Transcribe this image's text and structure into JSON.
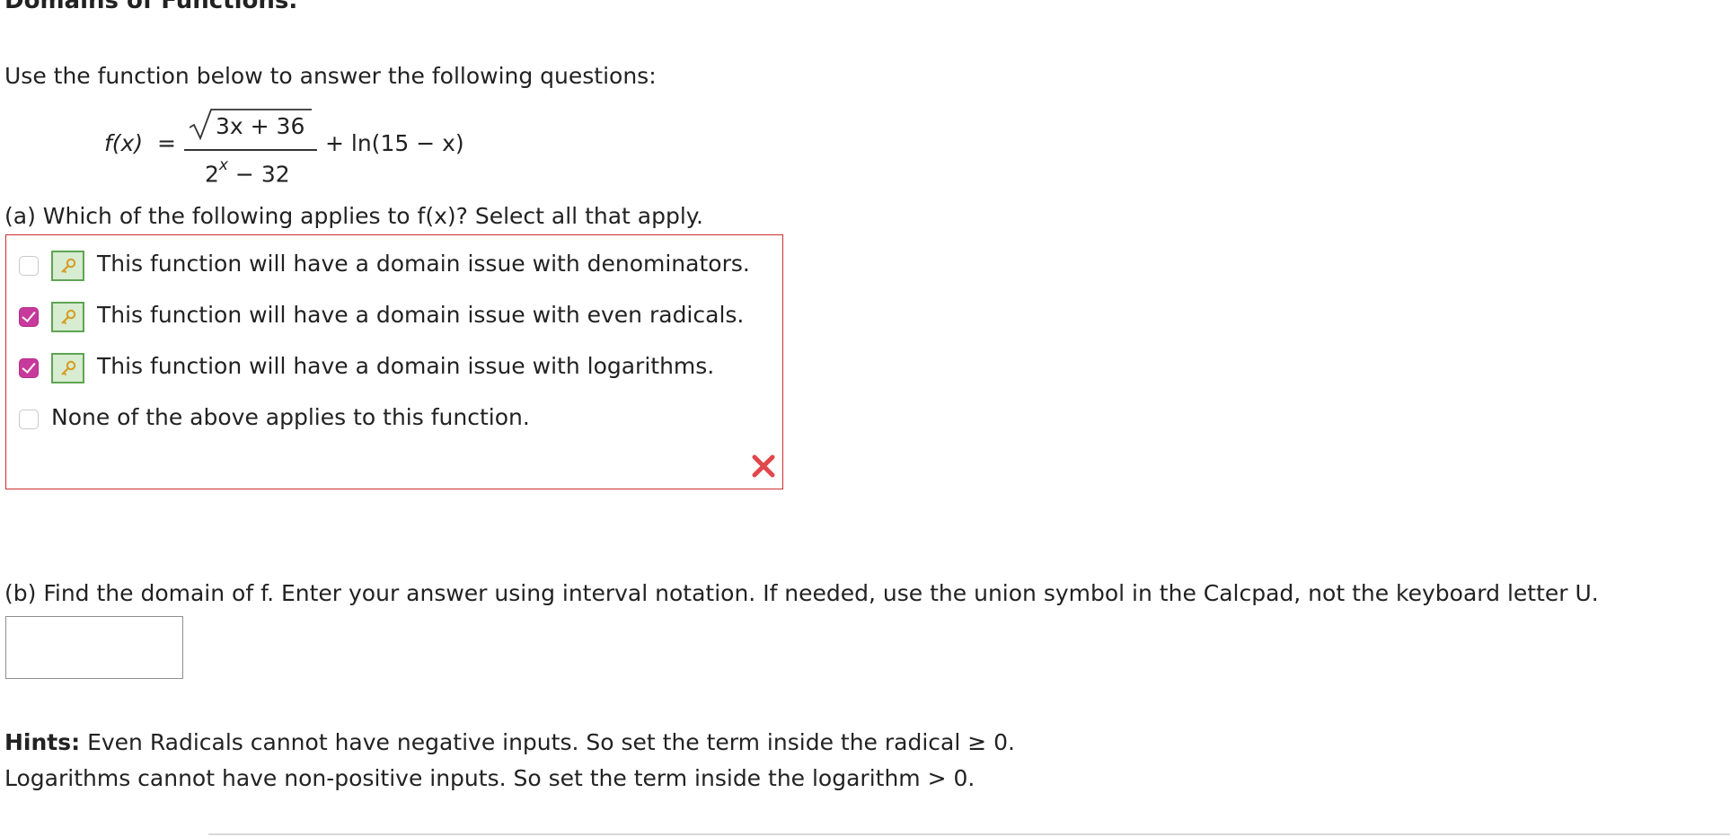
{
  "header": {
    "title": "Domains of Functions."
  },
  "intro": "Use the function below to answer the following questions:",
  "function": {
    "lhs": "f(x)",
    "equals": "=",
    "numerator": "3x + 36",
    "denominator_base": "2",
    "denominator_exponent": "x",
    "denominator_rest": "− 32",
    "tail": "+ ln(15 − x)"
  },
  "part_a": {
    "question": "(a) Which of the following applies to f(x)? Select all that apply.",
    "options": [
      {
        "label": "This function will have a domain issue with denominators.",
        "checked": false,
        "has_key": true
      },
      {
        "label": "This function will have a domain issue with even radicals.",
        "checked": true,
        "has_key": true
      },
      {
        "label": "This function will have a domain issue with logarithms.",
        "checked": true,
        "has_key": true
      },
      {
        "label": "None of the above applies to this function.",
        "checked": false,
        "has_key": false
      }
    ],
    "status_icon": "incorrect-x-icon"
  },
  "part_b": {
    "question": "(b) Find the domain of f. Enter your answer using interval notation. If needed, use the union symbol in the Calcpad, not the keyboard letter U.",
    "answer_value": ""
  },
  "hints": {
    "label": "Hints:",
    "line1": " Even Radicals cannot have negative inputs. So set the term inside the radical ≥ 0.",
    "line2": "Logarithms cannot have non-positive inputs. So set the term inside the logarithm > 0."
  },
  "colors": {
    "answer_box_border": "#cc2d2d",
    "checked_box": "#c8399c",
    "key_badge_border": "#5fa453",
    "key_badge_fill": "#d7ecd0",
    "incorrect_mark": "#e0474c"
  }
}
